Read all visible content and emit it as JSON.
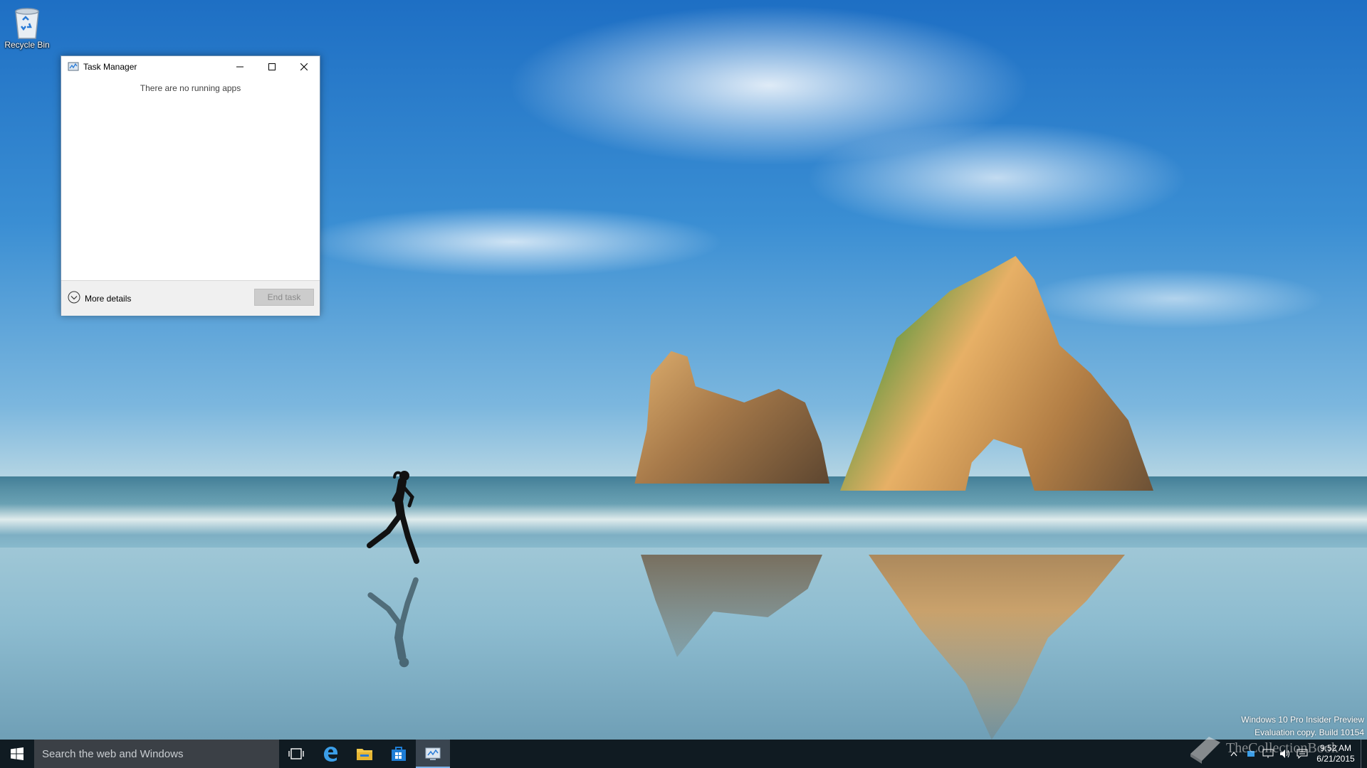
{
  "desktop": {
    "icons": [
      {
        "label": "Recycle Bin",
        "icon": "recycle-bin-icon"
      }
    ]
  },
  "task_manager": {
    "title": "Task Manager",
    "empty_message": "There are no running apps",
    "more_details_label": "More details",
    "end_task_label": "End task",
    "end_task_enabled": false
  },
  "taskbar": {
    "search_placeholder": "Search the web and Windows",
    "pinned": [
      {
        "name": "task-view",
        "icon": "task-view-icon"
      },
      {
        "name": "edge",
        "icon": "edge-icon"
      },
      {
        "name": "file-explorer",
        "icon": "folder-icon"
      },
      {
        "name": "store",
        "icon": "store-icon"
      },
      {
        "name": "task-manager",
        "icon": "task-manager-icon",
        "active": true
      }
    ],
    "clock_time": "9:52 AM",
    "clock_date": "6/21/2015",
    "accent_color": "#7eb4ea"
  },
  "watermark": {
    "line1": "Windows 10 Pro Insider Preview",
    "line2": "Evaluation copy. Build 10154"
  },
  "branding": {
    "text": "TheCollectionBook"
  }
}
